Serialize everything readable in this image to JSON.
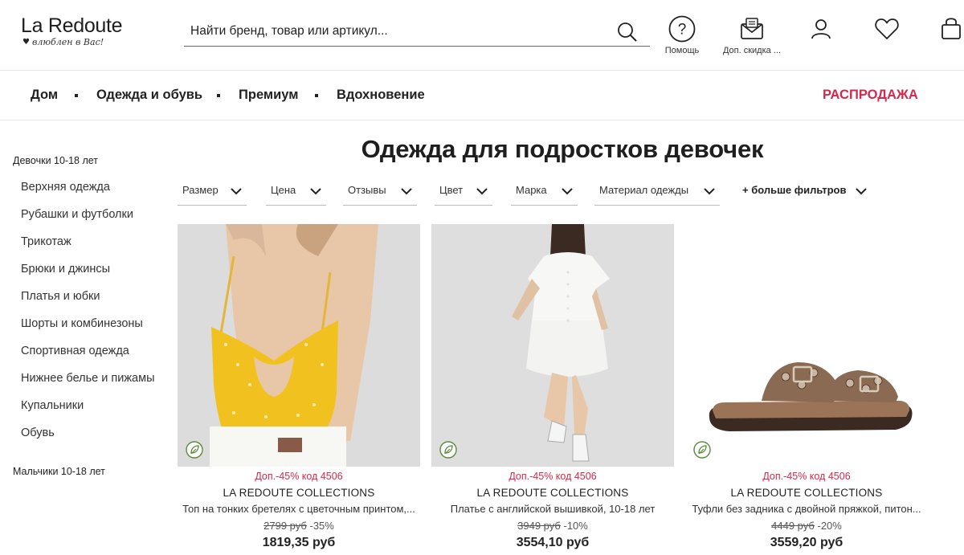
{
  "colors": {
    "accent": "#d4294c",
    "text": "#222222",
    "eco": "#5a8a3a"
  },
  "header": {
    "logo_text": "La Redoute",
    "logo_tagline": "влюблен в Вас!",
    "search_placeholder": "Найти бренд, товар или артикул...",
    "icons": [
      {
        "name": "help-icon",
        "label": "Помощь"
      },
      {
        "name": "discount-icon",
        "label": "Доп. скидка ..."
      },
      {
        "name": "account-icon",
        "label": ""
      },
      {
        "name": "wishlist-icon",
        "label": ""
      },
      {
        "name": "cart-icon",
        "label": ""
      }
    ]
  },
  "nav": {
    "items": [
      "Дом",
      "Одежда и обувь",
      "Премиум",
      "Вдохновение"
    ],
    "sale": "РАСПРОДАЖА"
  },
  "sidebar": {
    "group1": "Девочки 10-18 лет",
    "items": [
      "Верхняя одежда",
      "Рубашки и футболки",
      "Трикотаж",
      "Брюки и джинсы",
      "Платья и юбки",
      "Шорты и комбинезоны",
      "Спортивная одежда",
      "Нижнее белье и пижамы",
      "Купальники",
      "Обувь"
    ],
    "group2": "Мальчики 10-18 лет"
  },
  "page_title": "Одежда для подростков девочек",
  "filters": [
    "Размер",
    "Цена",
    "Отзывы",
    "Цвет",
    "Марка",
    "Материал одежды"
  ],
  "more_filters": "+ больше фильтров",
  "products": [
    {
      "promo": "Доп.-45% код 4506",
      "brand": "LA REDOUTE COLLECTIONS",
      "name": "Топ на тонких бретелях с цветочным принтом,...",
      "old_price": "2799 руб",
      "discount": "-35%",
      "price": "1819,35 руб",
      "image": "yellow-floral-crop-top"
    },
    {
      "promo": "Доп.-45% код 4506",
      "brand": "LA REDOUTE COLLECTIONS",
      "name": "Платье с английской вышивкой, 10-18 лет",
      "old_price": "3949 руб",
      "discount": "-10%",
      "price": "3554,10 руб",
      "image": "white-embroidered-dress"
    },
    {
      "promo": "Доп.-45% код 4506",
      "brand": "LA REDOUTE COLLECTIONS",
      "name": "Туфли без задника с двойной пряжкой, питон...",
      "old_price": "4449 руб",
      "discount": "-20%",
      "price": "3559,20 руб",
      "image": "snakeskin-double-buckle-sandal"
    }
  ]
}
